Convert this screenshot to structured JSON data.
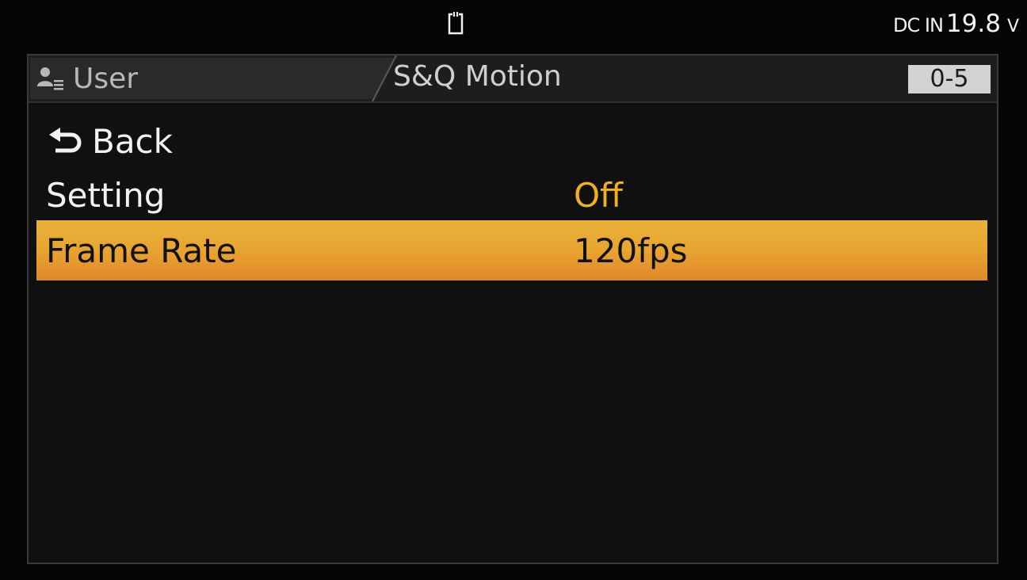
{
  "status_bar": {
    "media_icon": "memory-card-icon",
    "power_label": "DC IN",
    "power_value": "19.8",
    "power_unit": "V"
  },
  "header": {
    "user_icon": "user-menu-icon",
    "user_tab_label": "User",
    "page_title": "S&Q Motion",
    "page_number": "0-5"
  },
  "menu": {
    "back_icon": "back-arrow-icon",
    "back_label": "Back",
    "items": [
      {
        "label": "Setting",
        "value": "Off",
        "value_color": "#f0b020"
      },
      {
        "label": "Frame Rate",
        "value": "120fps",
        "selected": true
      }
    ]
  },
  "colors": {
    "highlight": "#e8a430",
    "accent_value": "#f0b020",
    "background": "#101010"
  }
}
